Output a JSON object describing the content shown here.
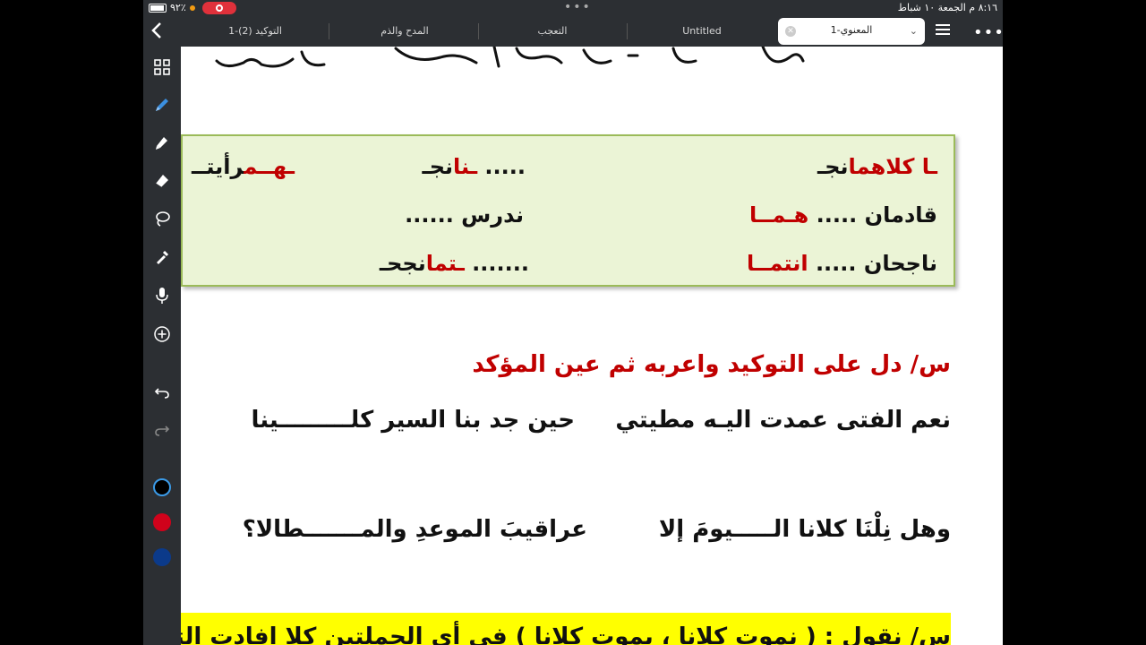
{
  "status": {
    "time": "٨:١٦ م  الجمعة ١٠ شباط",
    "battery": "٩٢٪"
  },
  "tabs": [
    {
      "label": "التوكيد (2)-1"
    },
    {
      "label": "المدح والذم"
    },
    {
      "label": "التعجب"
    },
    {
      "label": "Untitled"
    }
  ],
  "active_tab": {
    "label": "المعنوي-1"
  },
  "colors": {
    "chrome": "#2c2f33",
    "accent_blue": "#3b8fe0",
    "red_text": "#c00000",
    "green_box": "#ebf4d6",
    "highlight_yellow": "#ffff00",
    "swatch_black": "#000000",
    "swatch_red": "#d0021b",
    "swatch_navy": "#0b3a8a"
  },
  "toolbar": {
    "tools": [
      "grid-icon",
      "pen-icon",
      "highlighter-icon",
      "eraser-icon",
      "lasso-icon",
      "eyedropper-icon",
      "microphone-icon",
      "add-icon",
      "undo-icon",
      "redo-icon"
    ]
  },
  "green_box": {
    "row1": {
      "c_black": "نجـ",
      "c_red": "ـا كلاهما",
      "m_black": "نجـ",
      "m_red": "ـنا",
      "m_dots": ".....",
      "l_black": "رأيتــ",
      "l_red": "ـهــم"
    },
    "row2": {
      "c_red": "هـمــا",
      "c_black": "قادمان .....",
      "m_black": "ندرس ......"
    },
    "row3": {
      "c_red": "انتمــا",
      "c_black": "ناجحان .....",
      "m_black": "نجحـ",
      "m_red": "ـتما",
      "m_dots": "......."
    }
  },
  "question": "س/ دل على التوكيد واعربه ثم عين المؤكد",
  "verse1": {
    "first": "نعم الفتى عمدت اليـه مطيتي",
    "second": "حين جد بنا السير كلـــــــــينا"
  },
  "verse2": {
    "first": "وهل نِلْنَا كلانا الـــــيومَ إلا",
    "second": "عراقيبَ الموعدِ والمـــــــطالا؟"
  },
  "bottom_question": "س/ نقول : ( نموت كلانا ، يموت كلانا ) في أي الجملتين كلا افادت التوكيد"
}
